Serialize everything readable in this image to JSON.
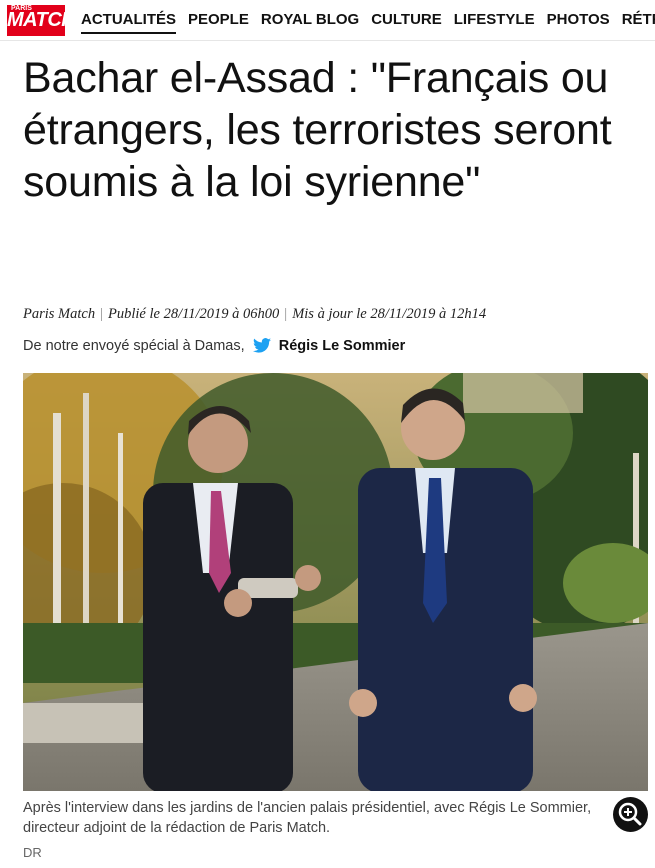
{
  "header": {
    "logo_text": "MATCH",
    "logo_small": "PARIS",
    "brand_color": "#e2001a",
    "nav": [
      "ACTUALITÉS",
      "PEOPLE",
      "ROYAL BLOG",
      "CULTURE",
      "LIFESTYLE",
      "PHOTOS",
      "RÉTRO"
    ]
  },
  "article": {
    "title": "Bachar el-Assad : \"Français ou étrangers, les terroristes seront soumis à la loi syrienne\"",
    "source": "Paris Match",
    "published": "Publié le 28/11/2019 à 06h00",
    "updated": "Mis à jour le 28/11/2019 à 12h14",
    "byline_prefix": "De notre envoyé spécial à Damas,",
    "author": "Régis Le Sommier",
    "caption_line1": "Après l'interview dans les jardins de l'ancien palais présidentiel, avec Régis Le Sommier,",
    "caption_line2": "directeur adjoint de la rédaction de Paris Match.",
    "credit": "DR"
  },
  "icons": {
    "twitter": "twitter-bird-icon",
    "zoom": "zoom-in-icon"
  }
}
